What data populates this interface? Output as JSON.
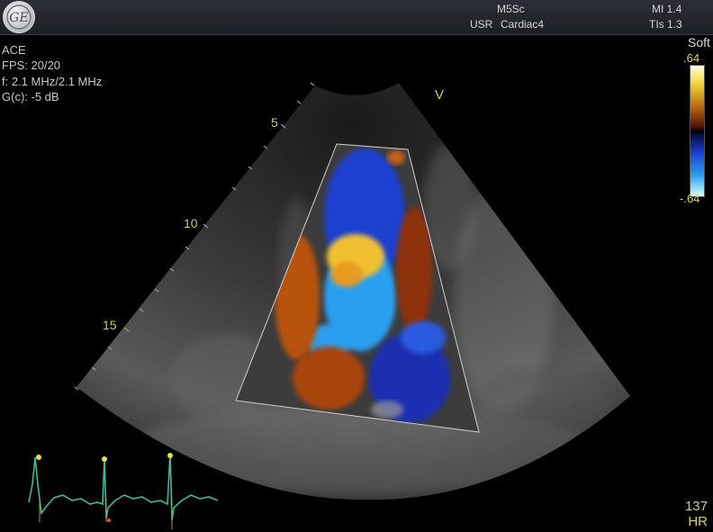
{
  "header": {
    "logo_text": "GE",
    "probe": "M5Sc",
    "preset_prefix": "USR",
    "preset": "Cardiac4",
    "mi": "MI 1.4",
    "tis": "TIs 1.3"
  },
  "readouts": {
    "mode": "ACE",
    "fps": "FPS: 20/20",
    "frequency": "f: 2.1 MHz/2.1 MHz",
    "gain": "G(c): -5 dB"
  },
  "colorbar": {
    "title": "Soft",
    "top_value": ".64",
    "bottom_value": "-.64",
    "positive_color": "#f1d43a",
    "negative_color": "#2a9ff0"
  },
  "depth_scale": {
    "label_5": "5",
    "label_10": "10",
    "label_15": "15"
  },
  "apex_marker": "V",
  "ecg": {
    "trace_color": "#3fb8a0",
    "marker_color": "#e8e04a"
  },
  "heart_rate": {
    "value": "137",
    "unit": "HR"
  }
}
